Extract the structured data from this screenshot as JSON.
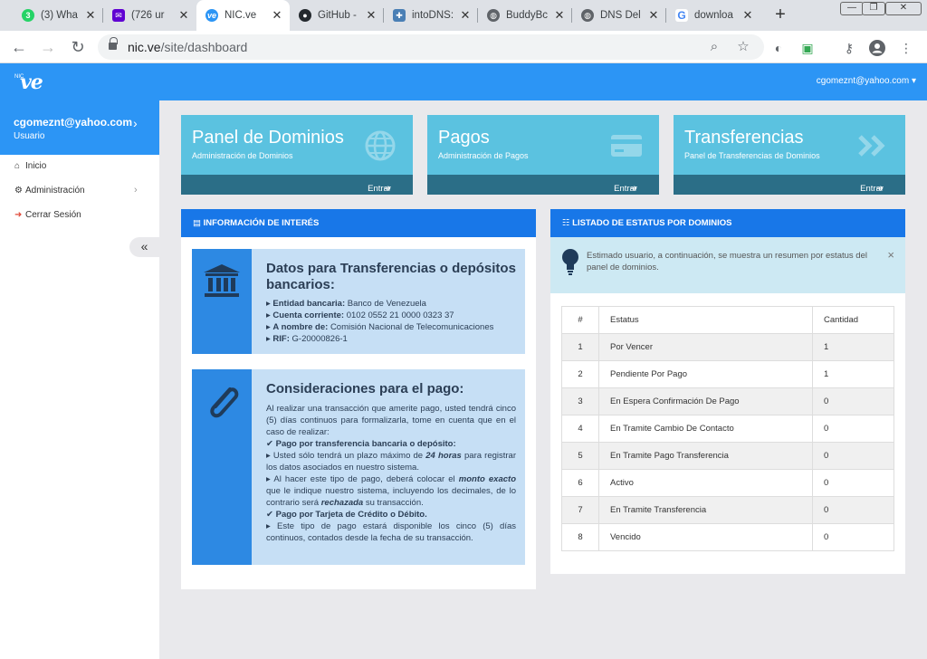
{
  "browser": {
    "tabs": [
      {
        "label": "(3) Wha",
        "icon": "whatsapp-icon",
        "color": "#25d366",
        "glyph": "3"
      },
      {
        "label": "(726 ur",
        "icon": "yahoo-mail-icon",
        "color": "#6001d2",
        "glyph": "✉"
      },
      {
        "label": "NIC.ve",
        "icon": "nicve-icon",
        "color": "#2c95f5",
        "glyph": "ve",
        "active": true
      },
      {
        "label": "GitHub -",
        "icon": "github-icon",
        "color": "#24292e",
        "glyph": "●"
      },
      {
        "label": "intoDNS:",
        "icon": "intodns-icon",
        "color": "#4a7fb5",
        "glyph": "✚"
      },
      {
        "label": "BuddyBc",
        "icon": "globe-icon",
        "color": "#5f6368",
        "glyph": "◍"
      },
      {
        "label": "DNS Del",
        "icon": "globe-icon",
        "color": "#5f6368",
        "glyph": "◍"
      },
      {
        "label": "downloa",
        "icon": "google-icon",
        "color": "#4285f4",
        "glyph": "G"
      }
    ],
    "new_tab": "+",
    "url_host": "nic.ve",
    "url_path": "/site/dashboard"
  },
  "header": {
    "logo_small": "NIC",
    "logo_text": "ve",
    "user_email": "cgomeznt@yahoo.com ▾"
  },
  "sidebar": {
    "email": "cgomeznt@yahoo.com",
    "role": "Usuario",
    "items": [
      {
        "label": "Inicio",
        "icon": "home-icon",
        "glyph": "⌂"
      },
      {
        "label": "Administración",
        "icon": "gear-icon",
        "glyph": "⚙"
      },
      {
        "label": "Cerrar Sesión",
        "icon": "sign-out-icon",
        "glyph": "➜"
      }
    ],
    "collapse": "«"
  },
  "cards": [
    {
      "title": "Panel de Dominios",
      "subtitle": "Administración de Dominios",
      "action": "Entrar",
      "icon": "globe-icon"
    },
    {
      "title": "Pagos",
      "subtitle": "Administración de Pagos",
      "action": "Entrar",
      "icon": "credit-card-icon"
    },
    {
      "title": "Transferencias",
      "subtitle": "Panel de Transferencias de Dominios",
      "action": "Entrar",
      "icon": "double-chevron-icon"
    }
  ],
  "info_panel": {
    "title": "INFORMACIÓN DE INTERÉS",
    "bank": {
      "heading": "Datos para Transferencias o depósitos bancarios:",
      "rows": [
        {
          "label": "Entidad bancaria:",
          "value": "Banco de Venezuela"
        },
        {
          "label": "Cuenta corriente:",
          "value": "0102 0552 21 0000 0323 37"
        },
        {
          "label": "A nombre de:",
          "value": "Comisión Nacional de Telecomunicaciones"
        },
        {
          "label": "RIF:",
          "value": "G-20000826-1"
        }
      ]
    },
    "payment": {
      "heading": "Consideraciones para el pago:",
      "intro": "Al realizar una transacción que amerite pago, usted tendrá cinco (5) días continuos para formalizarla, tome en cuenta que en el caso de realizar:",
      "bank_title": "Pago por transferencia bancaria o depósito:",
      "bank_p1_a": "Usted sólo tendrá un plazo máximo de",
      "bank_p1_b": "24 horas",
      "bank_p1_c": "para registrar los datos asociados en nuestro sistema.",
      "bank_p2_a": "Al hacer este tipo de pago, deberá colocar el",
      "bank_p2_b": "monto exacto",
      "bank_p2_c": "que le indique nuestro sistema, incluyendo los decimales, de lo contrario será",
      "bank_p2_d": "rechazada",
      "bank_p2_e": "su transacción.",
      "card_title": "Pago por Tarjeta de Crédito o Débito.",
      "card_p": "Este tipo de pago estará disponible los cinco (5) días continuos, contados desde la fecha de su transacción."
    }
  },
  "status_panel": {
    "title": "LISTADO DE ESTATUS POR DOMINIOS",
    "notice": "Estimado usuario, a continuación, se muestra un resumen por estatus del panel de dominios.",
    "close": "×",
    "columns": [
      "#",
      "Estatus",
      "Cantidad"
    ],
    "rows": [
      {
        "n": "1",
        "status": "Por Vencer",
        "count": "1"
      },
      {
        "n": "2",
        "status": "Pendiente Por Pago",
        "count": "1"
      },
      {
        "n": "3",
        "status": "En Espera Confirmación De Pago",
        "count": "0"
      },
      {
        "n": "4",
        "status": "En Tramite Cambio De Contacto",
        "count": "0"
      },
      {
        "n": "5",
        "status": "En Tramite Pago Transferencia",
        "count": "0"
      },
      {
        "n": "6",
        "status": "Activo",
        "count": "0"
      },
      {
        "n": "7",
        "status": "En Tramite Transferencia",
        "count": "0"
      },
      {
        "n": "8",
        "status": "Vencido",
        "count": "0"
      }
    ]
  },
  "colors": {
    "brand_blue": "#2c95f5",
    "panel_head": "#1877e8",
    "card_bg": "#5bc2e0",
    "card_foot": "#2b6e87"
  }
}
